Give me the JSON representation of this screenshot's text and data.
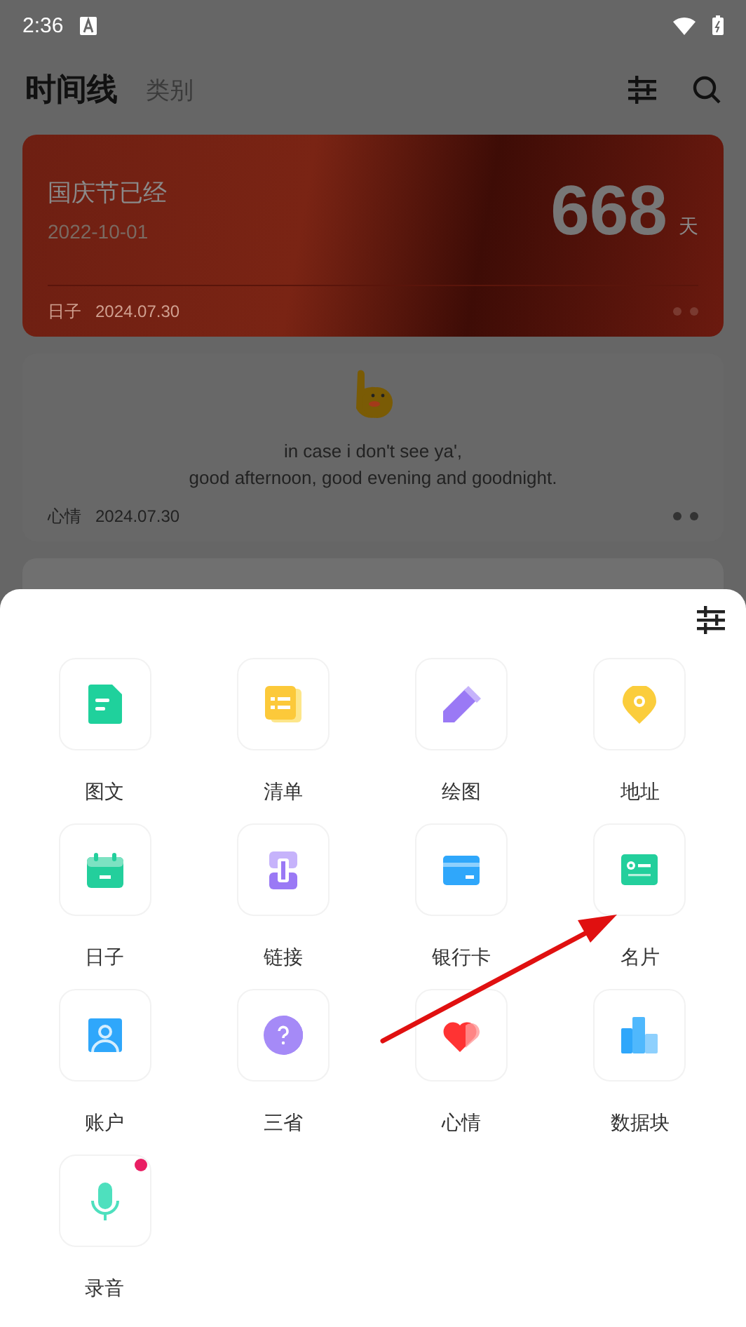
{
  "status_bar": {
    "time": "2:36"
  },
  "header": {
    "title": "时间线",
    "tabs": [
      {
        "label": "类别",
        "selected": false
      }
    ]
  },
  "cards": [
    {
      "kind": "countdown",
      "title": "国庆节已经",
      "date": "2022-10-01",
      "count": "668",
      "unit": "天",
      "category": "日子",
      "created": "2024.07.30"
    },
    {
      "kind": "mood",
      "text": "in case i don't see ya',\ngood afternoon, good evening and goodnight.",
      "category": "心情",
      "created": "2024.07.30"
    },
    {
      "kind": "partial"
    }
  ],
  "sheet": {
    "items": [
      {
        "label": "图文",
        "kind": "document",
        "badge": false
      },
      {
        "label": "清单",
        "kind": "list",
        "badge": false
      },
      {
        "label": "绘图",
        "kind": "pencil",
        "badge": false
      },
      {
        "label": "地址",
        "kind": "pin",
        "badge": false
      },
      {
        "label": "日子",
        "kind": "calendar",
        "badge": false
      },
      {
        "label": "链接",
        "kind": "link",
        "badge": false
      },
      {
        "label": "银行卡",
        "kind": "bankcard",
        "badge": false
      },
      {
        "label": "名片",
        "kind": "idcard",
        "badge": false
      },
      {
        "label": "账户",
        "kind": "person",
        "badge": false
      },
      {
        "label": "三省",
        "kind": "question",
        "badge": false
      },
      {
        "label": "心情",
        "kind": "heart",
        "badge": false
      },
      {
        "label": "数据块",
        "kind": "bars",
        "badge": false
      },
      {
        "label": "录音",
        "kind": "mic",
        "badge": true
      }
    ]
  }
}
